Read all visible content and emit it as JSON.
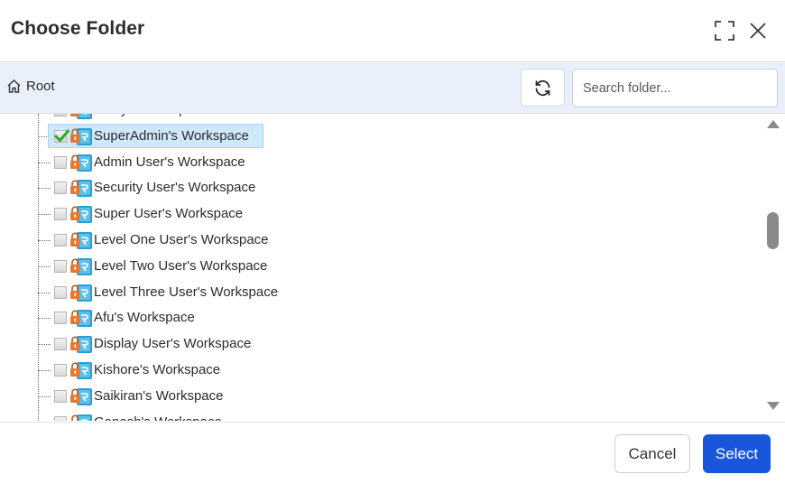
{
  "dialog": {
    "title": "Choose Folder",
    "maximize_icon": "expand-icon",
    "close_icon": "close-icon"
  },
  "toolbar": {
    "breadcrumb": {
      "icon": "home-icon",
      "label": "Root"
    },
    "refresh_icon": "refresh-icon",
    "search": {
      "placeholder": "Search folder...",
      "value": ""
    }
  },
  "tree": {
    "items": [
      {
        "label": "Vinay's Workspace",
        "checked": false,
        "selected": false
      },
      {
        "label": "SuperAdmin's Workspace",
        "checked": true,
        "selected": true
      },
      {
        "label": "Admin User's Workspace",
        "checked": false,
        "selected": false
      },
      {
        "label": "Security User's Workspace",
        "checked": false,
        "selected": false
      },
      {
        "label": "Super User's Workspace",
        "checked": false,
        "selected": false
      },
      {
        "label": "Level One User's Workspace",
        "checked": false,
        "selected": false
      },
      {
        "label": "Level Two User's Workspace",
        "checked": false,
        "selected": false
      },
      {
        "label": "Level Three User's Workspace",
        "checked": false,
        "selected": false
      },
      {
        "label": "Afu's Workspace",
        "checked": false,
        "selected": false
      },
      {
        "label": "Display User's Workspace",
        "checked": false,
        "selected": false
      },
      {
        "label": "Kishore's Workspace",
        "checked": false,
        "selected": false
      },
      {
        "label": "Saikiran's Workspace",
        "checked": false,
        "selected": false
      },
      {
        "label": "Ganesh's Workspace",
        "checked": false,
        "selected": false
      }
    ]
  },
  "footer": {
    "cancel_label": "Cancel",
    "select_label": "Select"
  },
  "colors": {
    "accent": "#1a56db",
    "toolbar_bg": "#eaf0fb",
    "selection_bg": "#cfe9fb",
    "lock_orange": "#e8772e",
    "workspace_blue": "#2a9fd6"
  }
}
